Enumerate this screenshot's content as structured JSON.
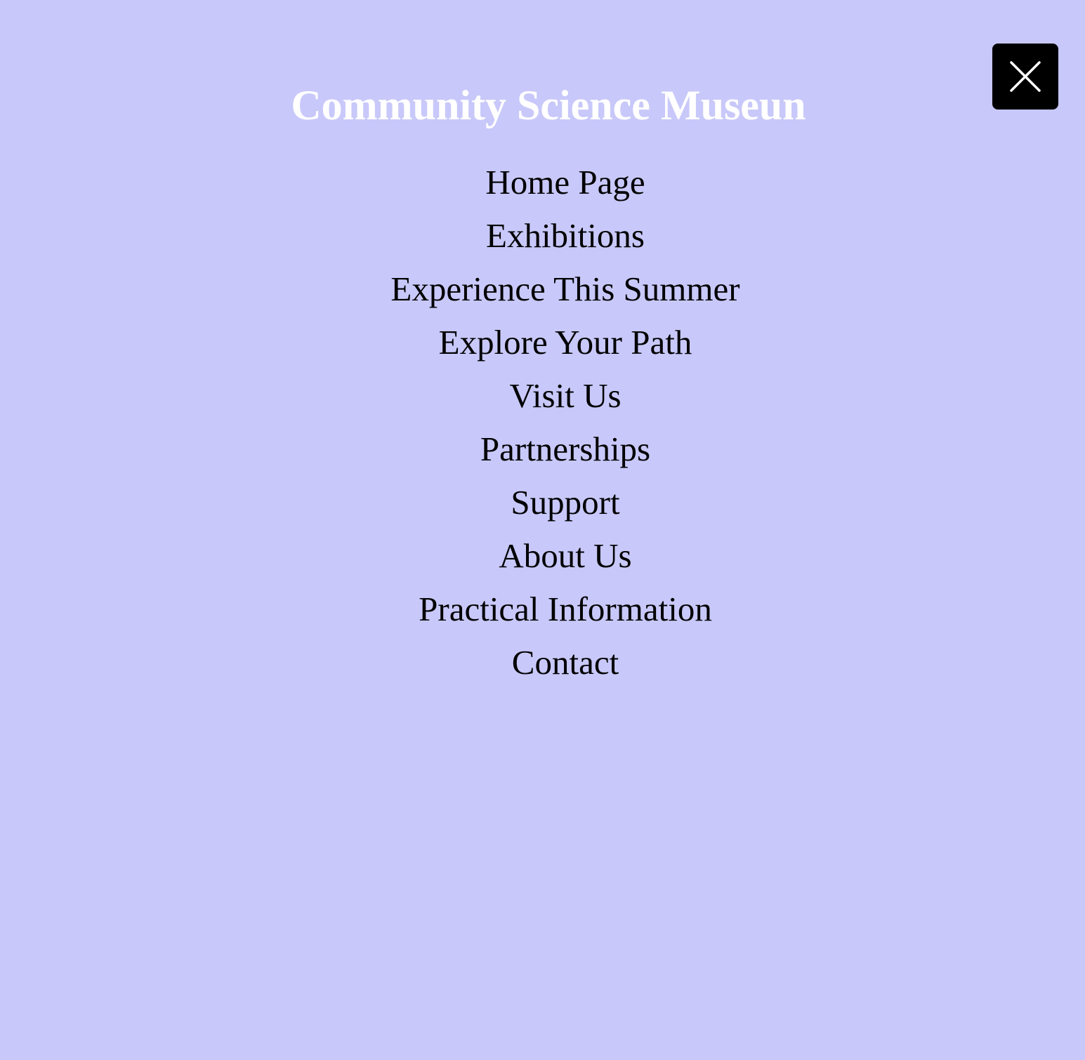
{
  "colors": {
    "background": "#c8c8fa",
    "title_text": "#ffffff",
    "menu_text": "#000000",
    "close_button_bg": "#000000",
    "close_icon": "#ffffff"
  },
  "header": {
    "title": "Community Science Museun",
    "close_icon": "close-icon"
  },
  "menu": {
    "items": [
      {
        "label": "Home Page"
      },
      {
        "label": "Exhibitions"
      },
      {
        "label": "Experience This Summer"
      },
      {
        "label": "Explore Your Path"
      },
      {
        "label": "Visit Us"
      },
      {
        "label": "Partnerships"
      },
      {
        "label": "Support"
      },
      {
        "label": "About Us"
      },
      {
        "label": "Practical Information"
      },
      {
        "label": "Contact"
      }
    ]
  }
}
